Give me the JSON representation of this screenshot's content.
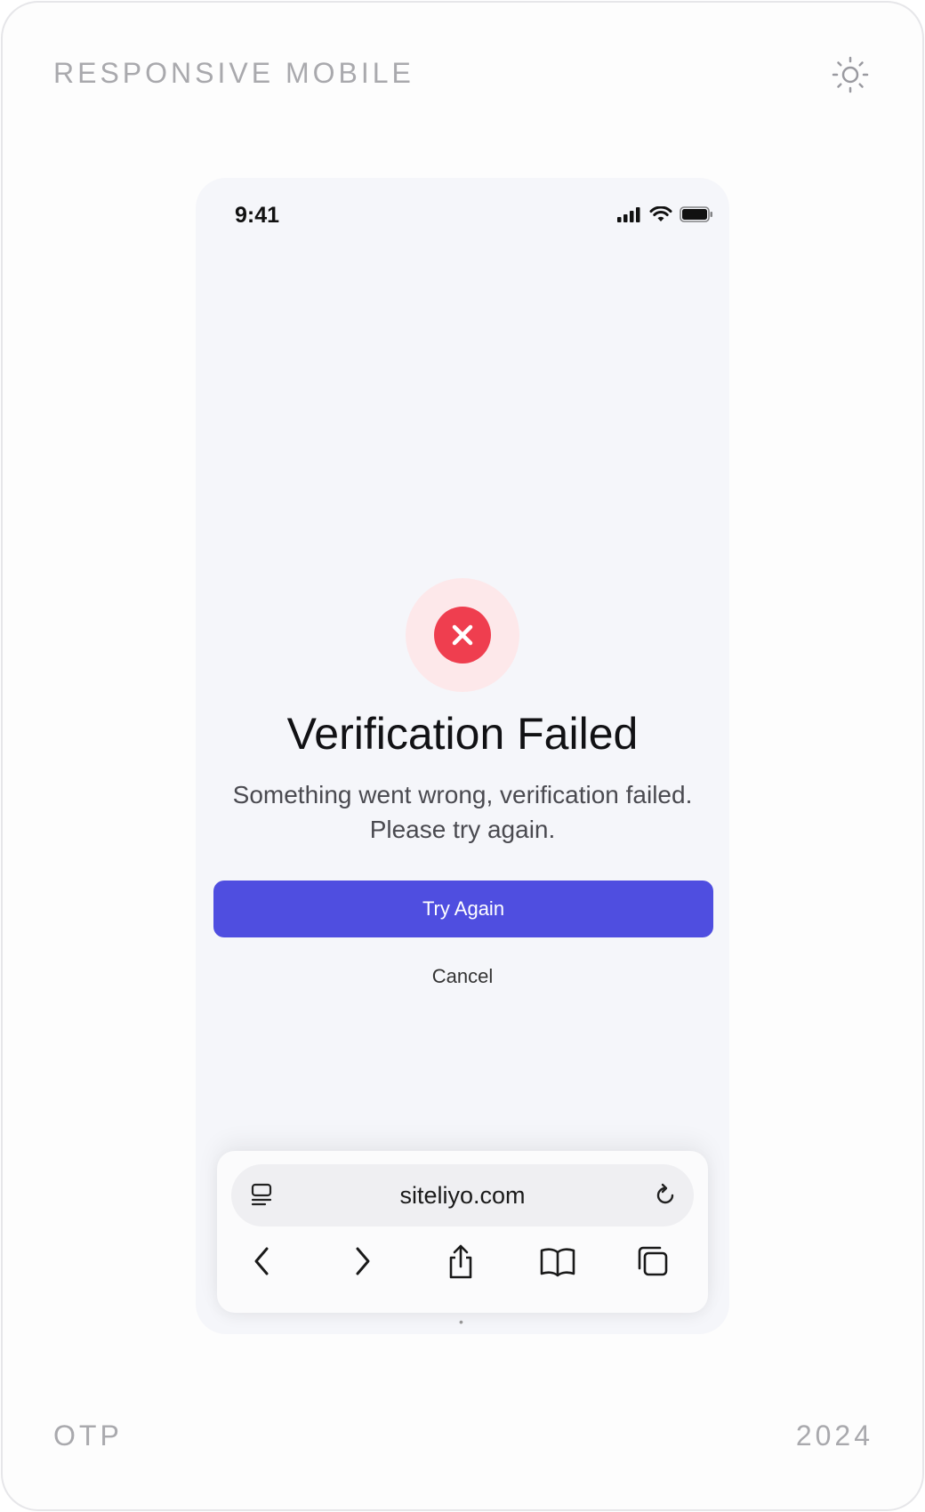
{
  "corners": {
    "top_left": "RESPONSIVE MOBILE",
    "bottom_left": "OTP",
    "bottom_right": "2024"
  },
  "icons": {
    "theme": "sun-icon",
    "error": "close-icon",
    "signal": "cellular-signal-icon",
    "wifi": "wifi-icon",
    "battery": "battery-icon",
    "tabs_list": "tab-list-icon",
    "reload": "reload-icon",
    "back": "chevron-left-icon",
    "forward": "chevron-right-icon",
    "share": "share-icon",
    "bookmarks": "book-icon",
    "tabs": "tabs-icon"
  },
  "status_bar": {
    "time": "9:41"
  },
  "result": {
    "title": "Verification Failed",
    "message": "Something went wrong, verification failed. Please try again."
  },
  "actions": {
    "primary": "Try Again",
    "secondary": "Cancel"
  },
  "browser": {
    "url": "siteliyo.com"
  },
  "colors": {
    "accent": "#4f4ee0",
    "error": "#ef3e4f",
    "error_halo": "#fde8ea",
    "screen_bg": "#f5f6fa"
  }
}
